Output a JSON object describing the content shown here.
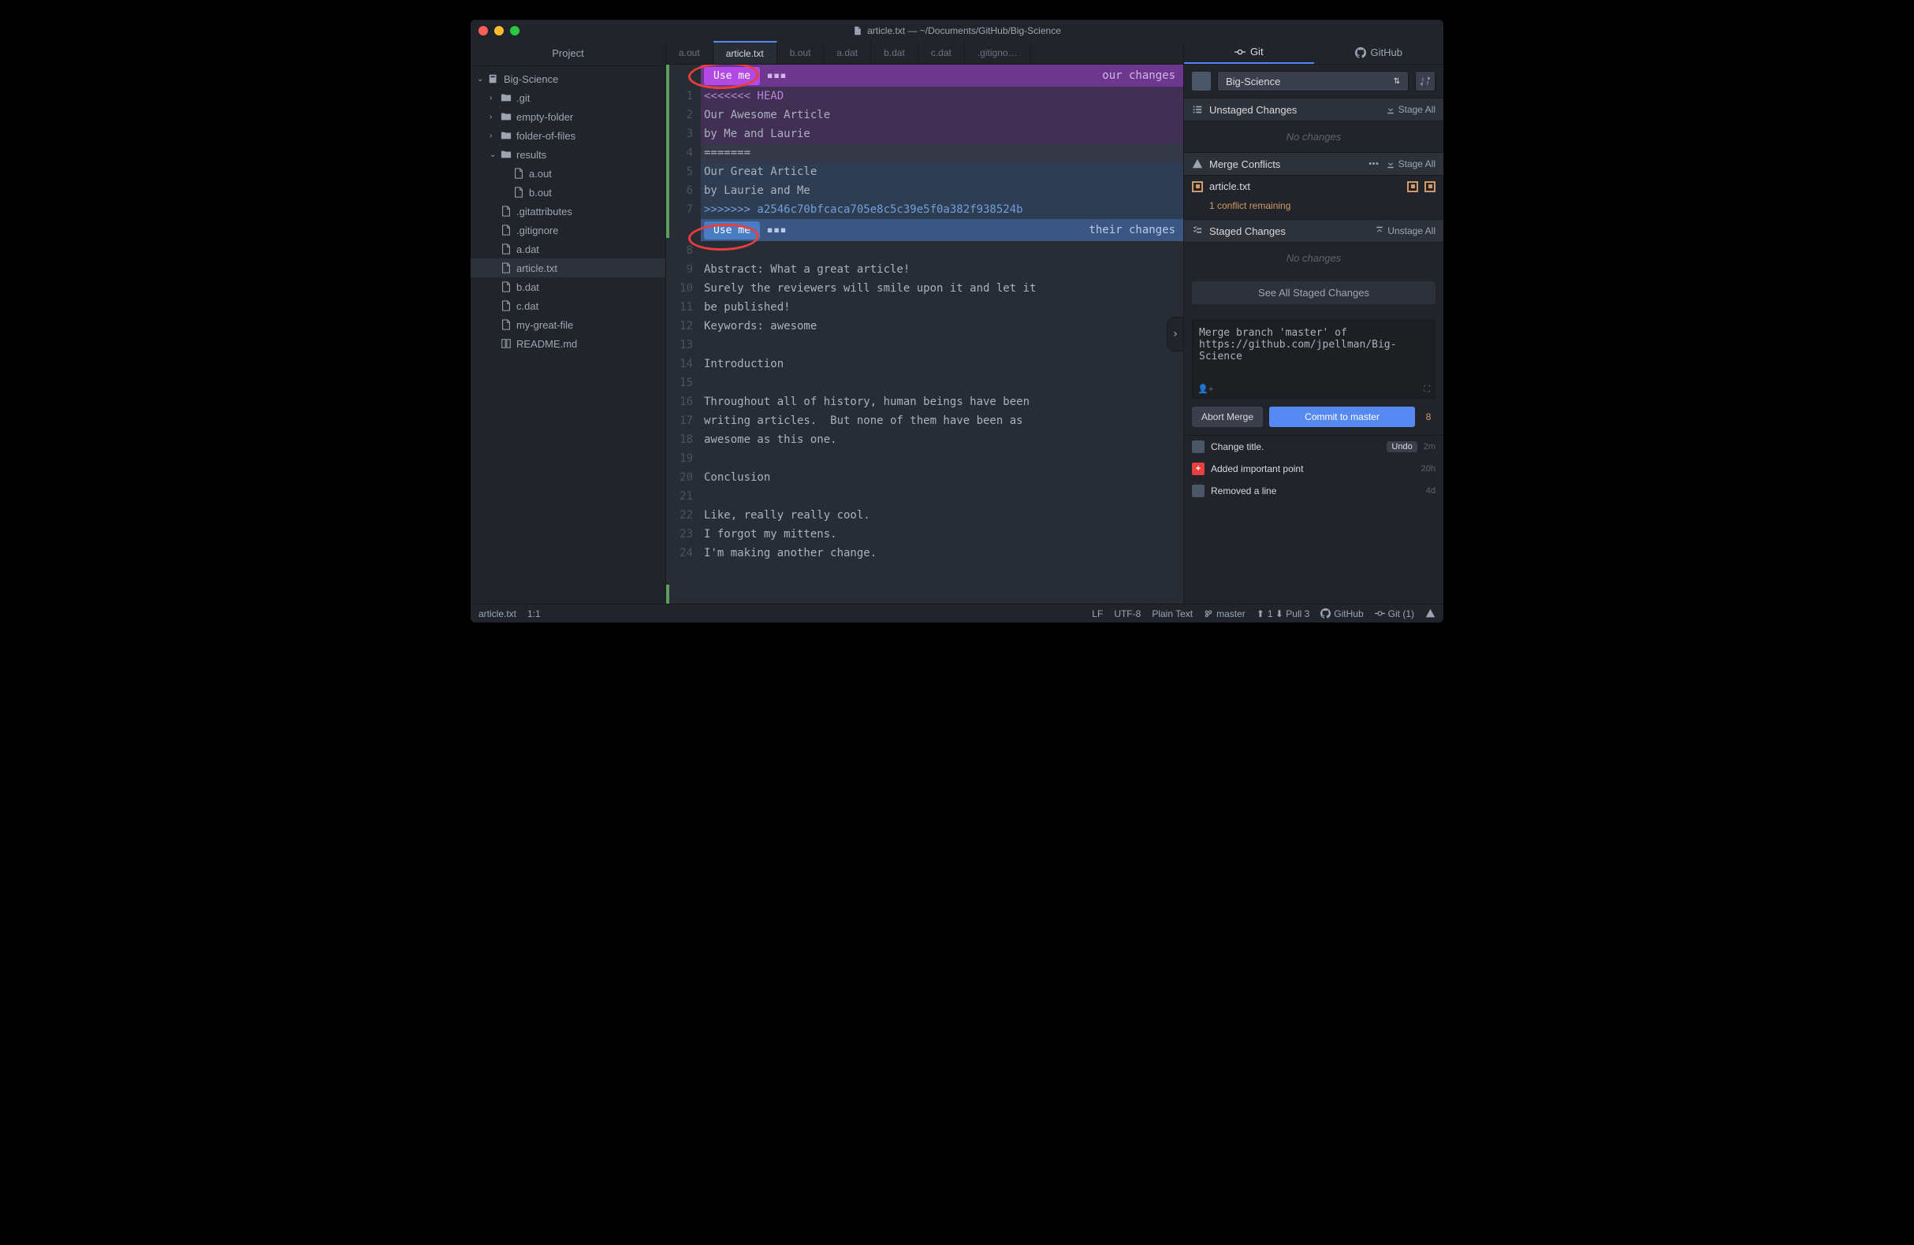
{
  "window": {
    "title": "article.txt — ~/Documents/GitHub/Big-Science"
  },
  "sidebar": {
    "header": "Project",
    "tree": {
      "root": "Big-Science",
      "items": [
        {
          "label": ".git",
          "type": "folder",
          "depth": 1,
          "collapsed": true
        },
        {
          "label": "empty-folder",
          "type": "folder",
          "depth": 1,
          "collapsed": true
        },
        {
          "label": "folder-of-files",
          "type": "folder",
          "depth": 1,
          "collapsed": true
        },
        {
          "label": "results",
          "type": "folder",
          "depth": 1,
          "collapsed": false
        },
        {
          "label": "a.out",
          "type": "file",
          "depth": 2
        },
        {
          "label": "b.out",
          "type": "file",
          "depth": 2
        },
        {
          "label": ".gitattributes",
          "type": "file",
          "depth": 1
        },
        {
          "label": ".gitignore",
          "type": "file",
          "depth": 1
        },
        {
          "label": "a.dat",
          "type": "file",
          "depth": 1
        },
        {
          "label": "article.txt",
          "type": "file",
          "depth": 1,
          "selected": true
        },
        {
          "label": "b.dat",
          "type": "file",
          "depth": 1
        },
        {
          "label": "c.dat",
          "type": "file",
          "depth": 1
        },
        {
          "label": "my-great-file",
          "type": "file",
          "depth": 1
        },
        {
          "label": "README.md",
          "type": "book",
          "depth": 1
        }
      ]
    }
  },
  "tabs": [
    {
      "label": "a.out"
    },
    {
      "label": "article.txt",
      "active": true
    },
    {
      "label": "b.out"
    },
    {
      "label": "a.dat"
    },
    {
      "label": "b.dat"
    },
    {
      "label": "c.dat"
    },
    {
      "label": ".gitigno…"
    }
  ],
  "conflict": {
    "use_me": "Use me",
    "our_changes": "our changes",
    "their_changes": "their changes"
  },
  "editor": {
    "lines": [
      {
        "n": 1,
        "text": "<<<<<<< HEAD",
        "cls": "ours-bg head-marker"
      },
      {
        "n": 2,
        "text": "Our Awesome Article",
        "cls": "ours-bg"
      },
      {
        "n": 3,
        "text": "by Me and Laurie",
        "cls": "ours-bg"
      },
      {
        "n": 4,
        "text": "=======",
        "cls": "sep-bg"
      },
      {
        "n": 5,
        "text": "Our Great Article",
        "cls": "theirs-bg"
      },
      {
        "n": 6,
        "text": "by Laurie and Me",
        "cls": "theirs-bg"
      },
      {
        "n": 7,
        "text": ">>>>>>> a2546c70bfcaca705e8c5c39e5f0a382f938524b",
        "cls": "theirs-bg theirs-marker"
      },
      {
        "n": 8,
        "text": ""
      },
      {
        "n": 9,
        "text": "Abstract: What a great article!"
      },
      {
        "n": 10,
        "text": "Surely the reviewers will smile upon it and let it"
      },
      {
        "n": 11,
        "text": "be published!"
      },
      {
        "n": 12,
        "text": "Keywords: awesome"
      },
      {
        "n": 13,
        "text": ""
      },
      {
        "n": 14,
        "text": "Introduction"
      },
      {
        "n": 15,
        "text": ""
      },
      {
        "n": 16,
        "text": "Throughout all of history, human beings have been"
      },
      {
        "n": 17,
        "text": "writing articles.  But none of them have been as"
      },
      {
        "n": 18,
        "text": "awesome as this one."
      },
      {
        "n": 19,
        "text": ""
      },
      {
        "n": 20,
        "text": "Conclusion"
      },
      {
        "n": 21,
        "text": ""
      },
      {
        "n": 22,
        "text": "Like, really really cool."
      },
      {
        "n": 23,
        "text": "I forgot my mittens."
      },
      {
        "n": 24,
        "text": "I'm making another change."
      }
    ]
  },
  "git": {
    "tab_git": "Git",
    "tab_github": "GitHub",
    "repo": "Big-Science",
    "unstaged": {
      "title": "Unstaged Changes",
      "action": "Stage All",
      "empty": "No changes"
    },
    "conflicts": {
      "title": "Merge Conflicts",
      "action": "Stage All",
      "file": "article.txt",
      "remaining": "1 conflict remaining"
    },
    "staged": {
      "title": "Staged Changes",
      "action": "Unstage All",
      "empty": "No changes"
    },
    "see_all": "See All Staged Changes",
    "commit_msg": "Merge branch 'master' of https://github.com/jpellman/Big-Science",
    "abort": "Abort Merge",
    "commit": "Commit to master",
    "count": "8",
    "recent": [
      {
        "label": "Change title.",
        "time": "2m",
        "undo": "Undo",
        "avatar": "user"
      },
      {
        "label": "Added important point",
        "time": "20h",
        "avatar": "plus"
      },
      {
        "label": "Removed a line",
        "time": "4d",
        "avatar": "user"
      }
    ]
  },
  "statusbar": {
    "file": "article.txt",
    "pos": "1:1",
    "eol": "LF",
    "encoding": "UTF-8",
    "lang": "Plain Text",
    "branch": "master",
    "sync": "1 ⬇ Pull 3",
    "github": "GitHub",
    "git": "Git (1)"
  }
}
